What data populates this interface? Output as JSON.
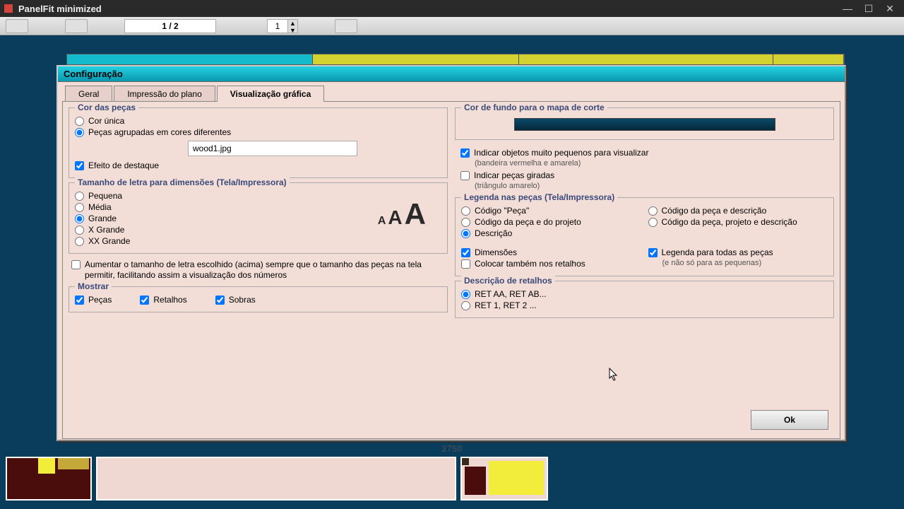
{
  "window": {
    "title": "PanelFit minimized"
  },
  "toolbar": {
    "pager": "1 / 2",
    "num": "1"
  },
  "dialog": {
    "title": "Configuração",
    "tabs": {
      "geral": "Geral",
      "impressao": "Impressão do plano",
      "visu": "Visualização gráfica"
    },
    "ok": "Ok"
  },
  "cor_pecas": {
    "legend": "Cor das peças",
    "unica": "Cor única",
    "diferentes": "Peças agrupadas em cores diferentes",
    "texture_file": "wood1.jpg",
    "destaque": "Efeito de destaque"
  },
  "fonte": {
    "legend": "Tamanho de letra para dimensões (Tela/Impressora)",
    "pequena": "Pequena",
    "media": "Média",
    "grande": "Grande",
    "xgrande": "X Grande",
    "xxgrande": "XX Grande",
    "aumentar": "Aumentar o tamanho de letra escolhido (acima) sempre que o tamanho das peças na tela permitir, facilitando assim a visualização dos números"
  },
  "mostrar": {
    "legend": "Mostrar",
    "pecas": "Peças",
    "retalhos": "Retalhos",
    "sobras": "Sobras"
  },
  "fundo": {
    "legend": "Cor de fundo para o mapa de corte"
  },
  "indicadores": {
    "pequenos": "Indicar objetos muito pequenos para visualizar",
    "pequenos_sub": "(bandeira vermelha e amarela)",
    "giradas": "Indicar peças giradas",
    "giradas_sub": "(triângulo amarelo)"
  },
  "legenda": {
    "legend": "Legenda nas peças (Tela/Impressora)",
    "codigo_peca": "Código \"Peça\"",
    "codigo_projeto": "Código da peça e do projeto",
    "descricao": "Descrição",
    "codigo_desc": "Código da peça e descrição",
    "codigo_proj_desc": "Código da peça, projeto e descrição",
    "dimensoes": "Dimensões",
    "retalhos": "Colocar também nos retalhos",
    "todas": "Legenda para todas as peças",
    "todas_sub": "(e não só para as pequenas)"
  },
  "desc_ret": {
    "legend": "Descrição de retalhos",
    "aa": "RET AA, RET AB...",
    "num": "RET 1, RET 2 ..."
  },
  "footer_dim": "2750"
}
